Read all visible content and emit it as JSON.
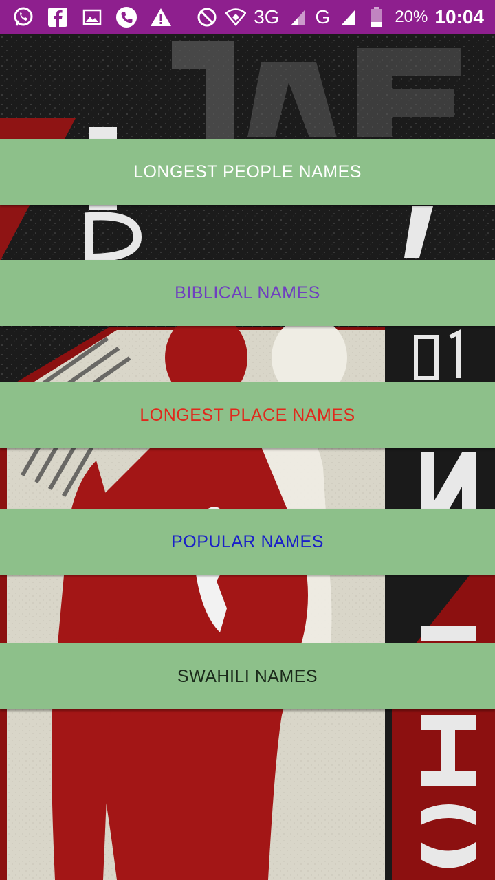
{
  "status_bar": {
    "network_label_1": "3G",
    "network_label_2": "G",
    "battery_percent": "20%",
    "time": "10:04",
    "left_icons": [
      "whatsapp-icon",
      "facebook-icon",
      "gallery-icon",
      "phone-icon",
      "warning-icon"
    ],
    "right_icons": [
      "no-disturb-icon",
      "wifi-icon",
      "signal-icon",
      "signal-icon",
      "battery-icon"
    ],
    "color": "#8e1f8e"
  },
  "menu": [
    {
      "label": "LONGEST PEOPLE NAMES",
      "color": "#ffffff"
    },
    {
      "label": "BIBLICAL NAMES",
      "color": "#6f3fbf"
    },
    {
      "label": "LONGEST PLACE NAMES",
      "color": "#e0281c"
    },
    {
      "label": "POPULAR NAMES",
      "color": "#1a1fc8"
    },
    {
      "label": "SWAHILI NAMES",
      "color": "#1b2a1b"
    }
  ],
  "button_color": "#8dc08a"
}
